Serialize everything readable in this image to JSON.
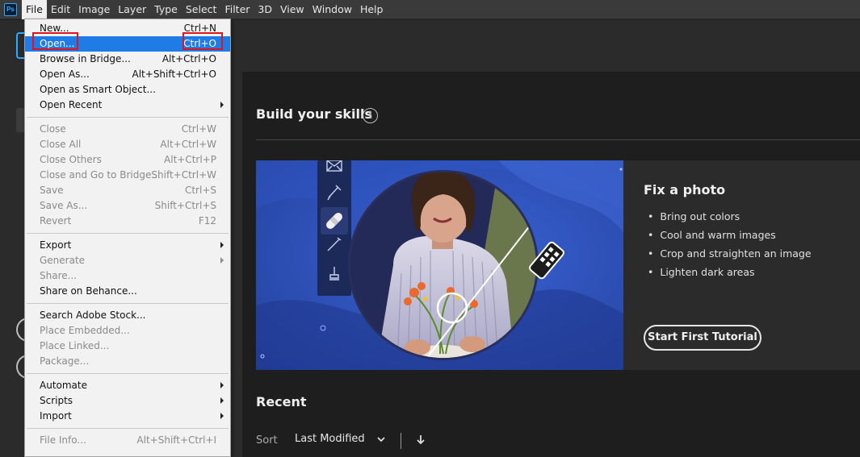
{
  "menubar": {
    "logo": "Ps",
    "items": [
      "File",
      "Edit",
      "Image",
      "Layer",
      "Type",
      "Select",
      "Filter",
      "3D",
      "View",
      "Window",
      "Help"
    ]
  },
  "file_menu": {
    "groups": [
      [
        {
          "label": "New...",
          "shortcut": "Ctrl+N",
          "disabled": false
        },
        {
          "label": "Open...",
          "shortcut": "Ctrl+O",
          "disabled": false,
          "highlighted": true
        },
        {
          "label": "Browse in Bridge...",
          "shortcut": "Alt+Ctrl+O",
          "disabled": false
        },
        {
          "label": "Open As...",
          "shortcut": "Alt+Shift+Ctrl+O",
          "disabled": false
        },
        {
          "label": "Open as Smart Object...",
          "shortcut": "",
          "disabled": false
        },
        {
          "label": "Open Recent",
          "shortcut": "",
          "disabled": false,
          "submenu": true
        }
      ],
      [
        {
          "label": "Close",
          "shortcut": "Ctrl+W",
          "disabled": true
        },
        {
          "label": "Close All",
          "shortcut": "Alt+Ctrl+W",
          "disabled": true
        },
        {
          "label": "Close Others",
          "shortcut": "Alt+Ctrl+P",
          "disabled": true
        },
        {
          "label": "Close and Go to Bridge...",
          "shortcut": "Shift+Ctrl+W",
          "disabled": true
        },
        {
          "label": "Save",
          "shortcut": "Ctrl+S",
          "disabled": true
        },
        {
          "label": "Save As...",
          "shortcut": "Shift+Ctrl+S",
          "disabled": true
        },
        {
          "label": "Revert",
          "shortcut": "F12",
          "disabled": true
        }
      ],
      [
        {
          "label": "Export",
          "shortcut": "",
          "disabled": false,
          "submenu": true
        },
        {
          "label": "Generate",
          "shortcut": "",
          "disabled": true,
          "submenu": true
        },
        {
          "label": "Share...",
          "shortcut": "",
          "disabled": true
        },
        {
          "label": "Share on Behance...",
          "shortcut": "",
          "disabled": false
        }
      ],
      [
        {
          "label": "Search Adobe Stock...",
          "shortcut": "",
          "disabled": false
        },
        {
          "label": "Place Embedded...",
          "shortcut": "",
          "disabled": true
        },
        {
          "label": "Place Linked...",
          "shortcut": "",
          "disabled": true
        },
        {
          "label": "Package...",
          "shortcut": "",
          "disabled": true
        }
      ],
      [
        {
          "label": "Automate",
          "shortcut": "",
          "disabled": false,
          "submenu": true
        },
        {
          "label": "Scripts",
          "shortcut": "",
          "disabled": false,
          "submenu": true
        },
        {
          "label": "Import",
          "shortcut": "",
          "disabled": false,
          "submenu": true
        }
      ],
      [
        {
          "label": "File Info...",
          "shortcut": "Alt+Shift+Ctrl+I",
          "disabled": true
        }
      ]
    ]
  },
  "home": {
    "skills_title": "Build your skills",
    "info_icon": "info-icon",
    "card": {
      "title": "Fix a photo",
      "bullets": [
        "Bring out colors",
        "Cool and warm images",
        "Crop and straighten an image",
        "Lighten dark areas"
      ],
      "button": "Start First Tutorial"
    },
    "recent_title": "Recent",
    "sort_label": "Sort",
    "sort_value": "Last Modified"
  },
  "colors": {
    "accent_blue": "#31a8ff",
    "highlight": "#1f7ce6",
    "annotation_red": "#e0141e"
  }
}
